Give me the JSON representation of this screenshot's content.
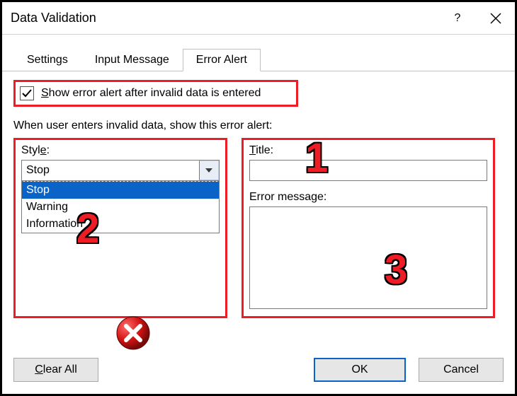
{
  "window": {
    "title": "Data Validation",
    "help": "?",
    "close": "×"
  },
  "tabs": {
    "settings": "Settings",
    "input_message": "Input Message",
    "error_alert": "Error Alert"
  },
  "checkbox": {
    "checked": true,
    "label_prefix_underline": "S",
    "label_rest": "how error alert after invalid data is entered"
  },
  "intro": "When user enters invalid data, show this error alert:",
  "style": {
    "label": "Styl",
    "label_u": "e",
    "label_suffix": ":",
    "value": "Stop",
    "options": [
      "Stop",
      "Warning",
      "Information"
    ],
    "selected_index": 0
  },
  "title_field": {
    "label_u": "T",
    "label_rest": "itle:",
    "value": ""
  },
  "error_message": {
    "label_prefix": "E",
    "label_rest": "rror message:",
    "value": ""
  },
  "buttons": {
    "clear_all_u": "C",
    "clear_all_rest": "lear All",
    "ok": "OK",
    "cancel": "Cancel"
  },
  "annotations": {
    "a1": "1",
    "a2": "2",
    "a3": "3"
  }
}
